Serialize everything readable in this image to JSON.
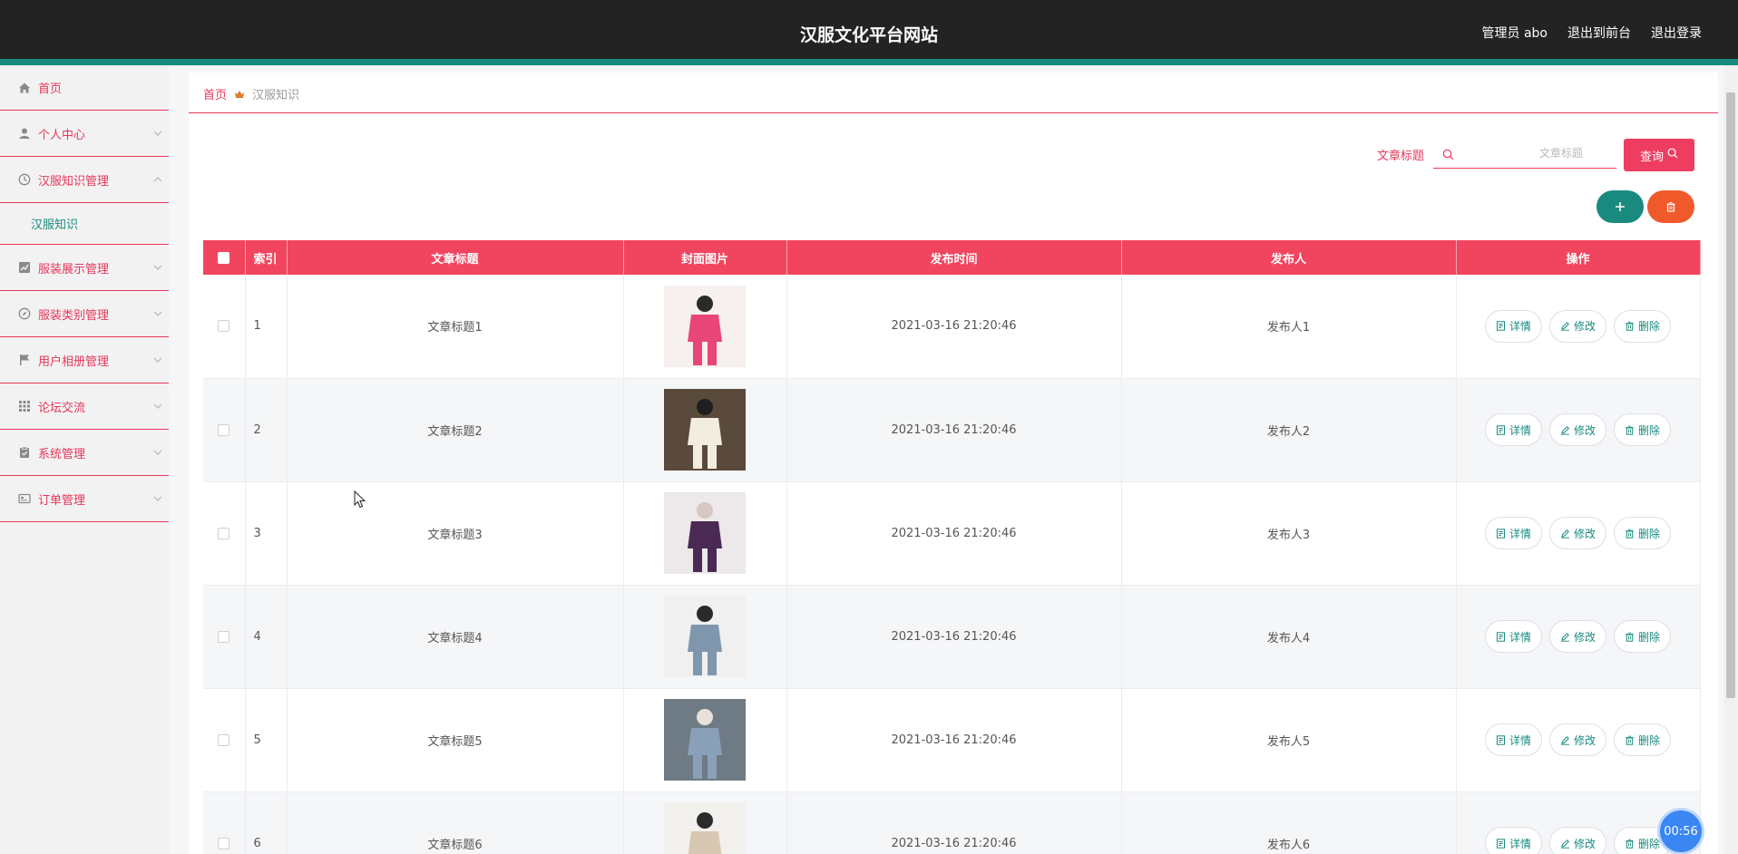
{
  "header": {
    "site_title": "汉服文化平台网站",
    "user_label": "管理员 abo",
    "to_front_label": "退出到前台",
    "logout_label": "退出登录"
  },
  "sidebar": {
    "items": [
      {
        "label": "首页",
        "icon": "home-icon"
      },
      {
        "label": "个人中心",
        "icon": "user-icon"
      },
      {
        "label": "汉服知识管理",
        "icon": "clock-icon",
        "expanded": true
      },
      {
        "label": "服装展示管理",
        "icon": "chart-icon"
      },
      {
        "label": "服装类别管理",
        "icon": "compass-icon"
      },
      {
        "label": "用户相册管理",
        "icon": "flag-icon"
      },
      {
        "label": "论坛交流",
        "icon": "grid-icon"
      },
      {
        "label": "系统管理",
        "icon": "clipboard-icon"
      },
      {
        "label": "订单管理",
        "icon": "card-icon"
      }
    ],
    "submenu_label": "汉服知识"
  },
  "breadcrumb": {
    "home": "首页",
    "current": "汉服知识"
  },
  "search": {
    "label": "文章标题",
    "placeholder": "文章标题",
    "value": "",
    "query_label": "查询"
  },
  "table": {
    "headers": {
      "index": "索引",
      "title": "文章标题",
      "cover": "封面图片",
      "time": "发布时间",
      "author": "发布人",
      "ops": "操作"
    },
    "actions": {
      "detail": "详情",
      "edit": "修改",
      "delete": "删除"
    },
    "rows": [
      {
        "index": "1",
        "title": "文章标题1",
        "time": "2021-03-16 21:20:46",
        "author": "发布人1"
      },
      {
        "index": "2",
        "title": "文章标题2",
        "time": "2021-03-16 21:20:46",
        "author": "发布人2"
      },
      {
        "index": "3",
        "title": "文章标题3",
        "time": "2021-03-16 21:20:46",
        "author": "发布人3"
      },
      {
        "index": "4",
        "title": "文章标题4",
        "time": "2021-03-16 21:20:46",
        "author": "发布人4"
      },
      {
        "index": "5",
        "title": "文章标题5",
        "time": "2021-03-16 21:20:46",
        "author": "发布人5"
      },
      {
        "index": "6",
        "title": "文章标题6",
        "time": "2021-03-16 21:20:46",
        "author": "发布人6"
      }
    ]
  },
  "timer": "00:56",
  "colors": {
    "header_bg": "#232323",
    "accent_teal": "#1a8a7e",
    "accent_red": "#e8375a",
    "table_head": "#f1455f",
    "delete_orange": "#f05a2a",
    "timer_blue": "#3a86f2"
  }
}
